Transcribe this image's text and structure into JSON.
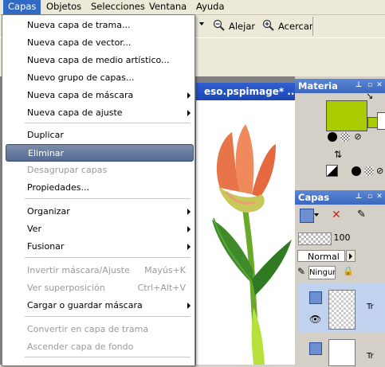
{
  "menubar": {
    "items": [
      "Capas",
      "Objetos",
      "Selecciones",
      "Ventana",
      "Ayuda"
    ]
  },
  "toolbar": {
    "zoom_out_label": "Alejar",
    "zoom_in_label": "Acercar"
  },
  "document": {
    "title": "eso.pspimage* ..."
  },
  "panels": {
    "materials_title": "Materia",
    "layers_title": "Capas",
    "opacity_value": "100",
    "blend_mode": "Normal",
    "mask_value": "Ningun",
    "layer_labels": [
      "Tr",
      "Tr"
    ]
  },
  "colors": {
    "foreground_swatch": "#a8cc00",
    "accent_title": "#3a67bb",
    "menu_highlight": "#566a92"
  },
  "menu": {
    "items": [
      {
        "label": "Nueva capa de trama...",
        "arrow": false,
        "disabled": false
      },
      {
        "label": "Nueva capa de vector...",
        "arrow": false,
        "disabled": false
      },
      {
        "label": "Nueva capa de medio artístico...",
        "arrow": false,
        "disabled": false
      },
      {
        "label": "Nuevo grupo de capas...",
        "arrow": false,
        "disabled": false
      },
      {
        "label": "Nueva capa de máscara",
        "arrow": true,
        "disabled": false
      },
      {
        "label": "Nueva capa de ajuste",
        "arrow": true,
        "disabled": false
      },
      {
        "label": "Duplicar",
        "arrow": false,
        "disabled": false
      },
      {
        "label": "Eliminar",
        "arrow": false,
        "disabled": false,
        "highlighted": true
      },
      {
        "label": "Desagrupar capas",
        "arrow": false,
        "disabled": true
      },
      {
        "label": "Propiedades...",
        "arrow": false,
        "disabled": false
      },
      {
        "label": "Organizar",
        "arrow": true,
        "disabled": false
      },
      {
        "label": "Ver",
        "arrow": true,
        "disabled": false
      },
      {
        "label": "Fusionar",
        "arrow": true,
        "disabled": false
      },
      {
        "label": "Invertir máscara/Ajuste",
        "shortcut": "Mayús+K",
        "disabled": true
      },
      {
        "label": "Ver superposición",
        "shortcut": "Ctrl+Alt+V",
        "disabled": true
      },
      {
        "label": "Cargar o guardar máscara",
        "arrow": true,
        "disabled": false
      },
      {
        "label": "Convertir en capa de trama",
        "arrow": false,
        "disabled": true
      },
      {
        "label": "Ascender capa de fondo",
        "arrow": false,
        "disabled": true
      }
    ]
  }
}
